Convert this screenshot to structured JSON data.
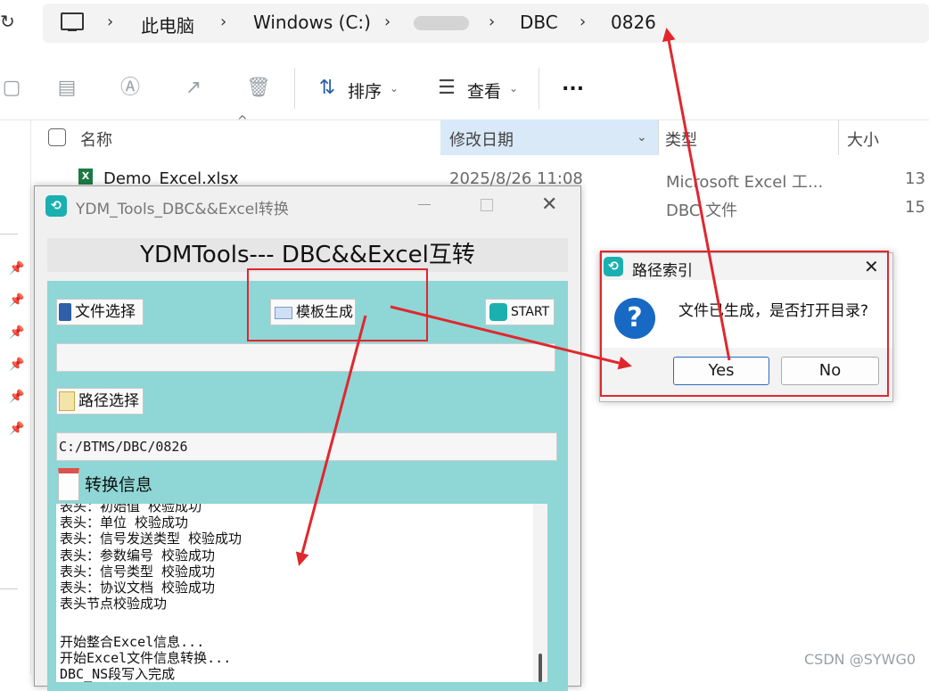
{
  "explorer": {
    "breadcrumb": {
      "items": [
        "此电脑",
        "Windows (C:)",
        "DBC",
        "0826"
      ]
    },
    "toolbar": {
      "sort_label": "排序",
      "view_label": "查看",
      "more_label": "..."
    },
    "columns": {
      "name": "名称",
      "modified": "修改日期",
      "type": "类型",
      "size": "大小"
    },
    "files": [
      {
        "name": "Demo_Excel.xlsx",
        "modified": "2025/8/26 11:08",
        "type": "Microsoft Excel 工...",
        "size": "13"
      },
      {
        "name": "",
        "modified": "",
        "type": "DBC 文件",
        "size": "15"
      }
    ]
  },
  "app": {
    "title": "YDM_Tools_DBC&&Excel转换",
    "banner": "YDMTools--- DBC&&Excel互转",
    "file_select_label": "文件选择",
    "template_label": "模板生成",
    "start_label": "START",
    "path_select_label": "路径选择",
    "file_path_value": "",
    "output_path_value": "C:/BTMS/DBC/0826",
    "info_label": "转换信息",
    "log_lines": [
      "表头：初始值 校验成功",
      "表头：单位 校验成功",
      "表头：信号发送类型 校验成功",
      "表头：参数编号 校验成功",
      "表头：信号类型 校验成功",
      "表头：协议文档 校验成功",
      "表头节点校验成功",
      "",
      "开始整合Excel信息...",
      "开始Excel文件信息转换...",
      "DBC_NS段写入完成"
    ]
  },
  "dialog": {
    "title": "路径索引",
    "message": "文件已生成，是否打开目录?",
    "yes_label": "Yes",
    "no_label": "No"
  },
  "watermark": "CSDN @SYWG0",
  "colors": {
    "panel": "#8fd6d6",
    "annotation": "#e0272e",
    "dialog_icon": "#1769c4"
  }
}
